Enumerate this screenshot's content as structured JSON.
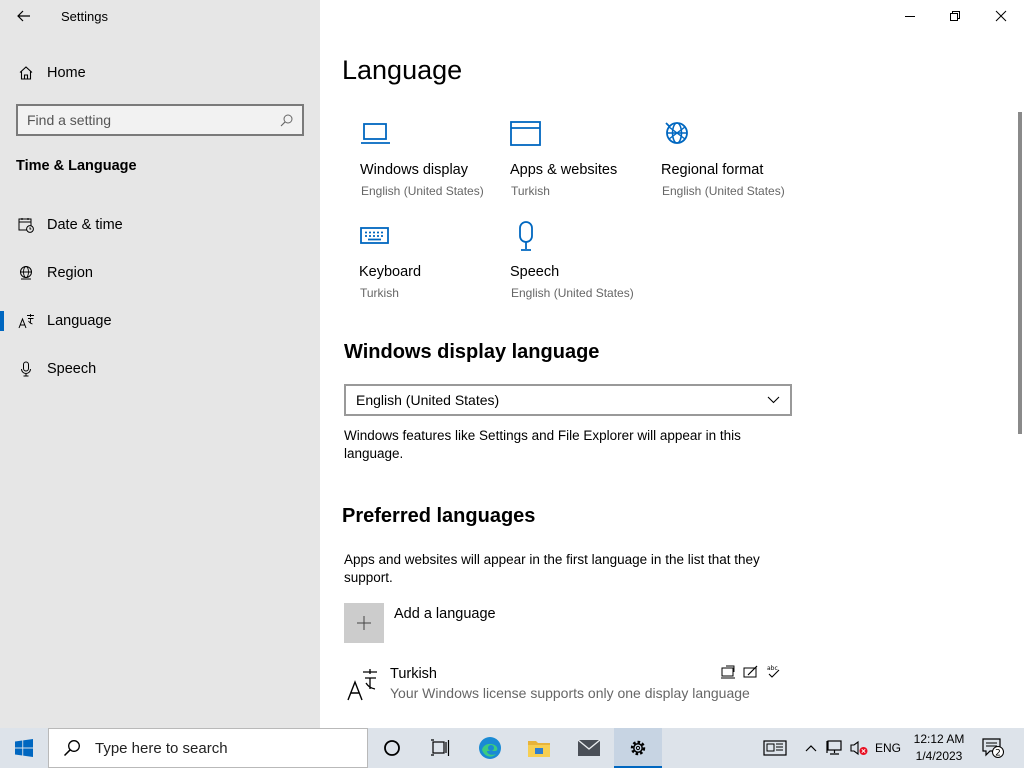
{
  "window": {
    "title": "Settings",
    "controls": {
      "minimize": "minimize",
      "restore": "restore",
      "close": "close"
    }
  },
  "sidebar": {
    "home_label": "Home",
    "search_placeholder": "Find a setting",
    "section_title": "Time & Language",
    "items": [
      {
        "label": "Date & time",
        "icon": "calendar-clock-icon"
      },
      {
        "label": "Region",
        "icon": "globe-icon"
      },
      {
        "label": "Language",
        "icon": "language-icon",
        "selected": true
      },
      {
        "label": "Speech",
        "icon": "microphone-icon"
      }
    ]
  },
  "main": {
    "page_title": "Language",
    "tiles": [
      {
        "name": "Windows display",
        "sub": "English (United States)",
        "icon": "monitor-icon"
      },
      {
        "name": "Apps & websites",
        "sub": "Turkish",
        "icon": "browser-window-icon"
      },
      {
        "name": "Regional format",
        "sub": "English (United States)",
        "icon": "globe-grid-icon"
      },
      {
        "name": "Keyboard",
        "sub": "Turkish",
        "icon": "keyboard-icon"
      },
      {
        "name": "Speech",
        "sub": "English (United States)",
        "icon": "microphone-icon"
      }
    ],
    "display_language": {
      "heading": "Windows display language",
      "selected": "English (United States)",
      "description": "Windows features like Settings and File Explorer will appear in this language."
    },
    "preferred": {
      "heading": "Preferred languages",
      "description": "Apps and websites will appear in the first language in the list that they support.",
      "add_label": "Add a language",
      "languages": [
        {
          "name": "Turkish",
          "note": "Your Windows license supports only one display language"
        }
      ]
    }
  },
  "taskbar": {
    "search_placeholder": "Type here to search",
    "language": "ENG",
    "time": "12:12 AM",
    "date": "1/4/2023",
    "notification_count": "2"
  },
  "colors": {
    "accent": "#0067c0",
    "sidebar_bg": "#e6e6e6",
    "taskbar_bg": "#dde3ea"
  }
}
